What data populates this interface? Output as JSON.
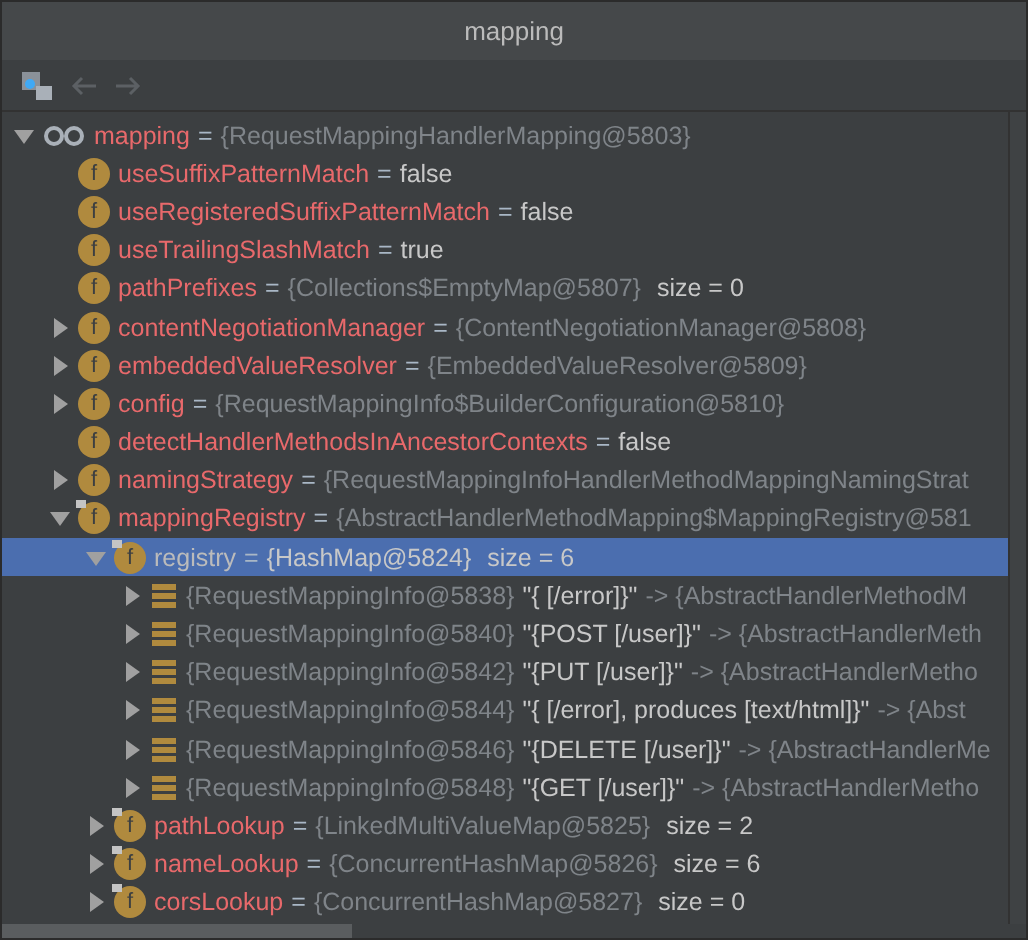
{
  "window": {
    "title": "mapping"
  },
  "toolbar": {
    "back_disabled": true,
    "forward_disabled": true
  },
  "tree": [
    {
      "kind": "watch",
      "name": "mapping",
      "sep": "=",
      "ref": "{RequestMappingHandlerMapping@5803}",
      "expanded": true,
      "selected": false,
      "children": [
        {
          "kind": "field",
          "icon": "f",
          "name": "useSuffixPatternMatch",
          "sep": "=",
          "value": "false",
          "final": false,
          "selected": false
        },
        {
          "kind": "field",
          "icon": "f",
          "name": "useRegisteredSuffixPatternMatch",
          "sep": "=",
          "value": "false",
          "final": false,
          "selected": false
        },
        {
          "kind": "field",
          "icon": "f",
          "name": "useTrailingSlashMatch",
          "sep": "=",
          "value": "true",
          "final": false,
          "selected": false
        },
        {
          "kind": "field",
          "icon": "f",
          "name": "pathPrefixes",
          "sep": "=",
          "ref": "{Collections$EmptyMap@5807}",
          "size": "size = 0",
          "final": false,
          "selected": false
        },
        {
          "kind": "field",
          "icon": "f",
          "name": "contentNegotiationManager",
          "sep": "=",
          "ref": "{ContentNegotiationManager@5808}",
          "final": false,
          "expanded": false,
          "selected": false
        },
        {
          "kind": "field",
          "icon": "f",
          "name": "embeddedValueResolver",
          "sep": "=",
          "ref": "{EmbeddedValueResolver@5809}",
          "final": false,
          "expanded": false,
          "selected": false
        },
        {
          "kind": "field",
          "icon": "f",
          "name": "config",
          "sep": "=",
          "ref": "{RequestMappingInfo$BuilderConfiguration@5810}",
          "final": false,
          "expanded": false,
          "selected": false
        },
        {
          "kind": "field",
          "icon": "f",
          "name": "detectHandlerMethodsInAncestorContexts",
          "sep": "=",
          "value": "false",
          "final": false,
          "selected": false
        },
        {
          "kind": "field",
          "icon": "f",
          "name": "namingStrategy",
          "sep": "=",
          "ref": "{RequestMappingInfoHandlerMethodMappingNamingStrat",
          "final": false,
          "expanded": false,
          "selected": false
        },
        {
          "kind": "field",
          "icon": "f",
          "name": "mappingRegistry",
          "sep": "=",
          "ref": "{AbstractHandlerMethodMapping$MappingRegistry@581",
          "final": true,
          "expanded": true,
          "selected": false,
          "children": [
            {
              "kind": "field",
              "icon": "f",
              "name": "registry",
              "sep": "=",
              "ref": "{HashMap@5824}",
              "size": "size = 6",
              "final": true,
              "expanded": true,
              "selected": true,
              "children": [
                {
                  "kind": "entry",
                  "key": "{RequestMappingInfo@5838}",
                  "label": "\"{ [/error]}\"",
                  "target": "-> {AbstractHandlerMethodM",
                  "expanded": false,
                  "selected": false
                },
                {
                  "kind": "entry",
                  "key": "{RequestMappingInfo@5840}",
                  "label": "\"{POST [/user]}\"",
                  "target": "-> {AbstractHandlerMeth",
                  "expanded": false,
                  "selected": false
                },
                {
                  "kind": "entry",
                  "key": "{RequestMappingInfo@5842}",
                  "label": "\"{PUT [/user]}\"",
                  "target": "-> {AbstractHandlerMetho",
                  "expanded": false,
                  "selected": false
                },
                {
                  "kind": "entry",
                  "key": "{RequestMappingInfo@5844}",
                  "label": "\"{ [/error], produces [text/html]}\"",
                  "target": "-> {Abst",
                  "expanded": false,
                  "selected": false
                },
                {
                  "kind": "entry",
                  "key": "{RequestMappingInfo@5846}",
                  "label": "\"{DELETE [/user]}\"",
                  "target": "-> {AbstractHandlerMe",
                  "expanded": false,
                  "selected": false
                },
                {
                  "kind": "entry",
                  "key": "{RequestMappingInfo@5848}",
                  "label": "\"{GET [/user]}\"",
                  "target": "-> {AbstractHandlerMetho",
                  "expanded": false,
                  "selected": false
                }
              ]
            },
            {
              "kind": "field",
              "icon": "f",
              "name": "pathLookup",
              "sep": "=",
              "ref": "{LinkedMultiValueMap@5825}",
              "size": "size = 2",
              "final": true,
              "expanded": false,
              "selected": false
            },
            {
              "kind": "field",
              "icon": "f",
              "name": "nameLookup",
              "sep": "=",
              "ref": "{ConcurrentHashMap@5826}",
              "size": "size = 6",
              "final": true,
              "expanded": false,
              "selected": false
            },
            {
              "kind": "field",
              "icon": "f",
              "name": "corsLookup",
              "sep": "=",
              "ref": "{ConcurrentHashMap@5827}",
              "size": "size = 0",
              "final": true,
              "expanded": false,
              "selected": false
            }
          ]
        }
      ]
    }
  ]
}
